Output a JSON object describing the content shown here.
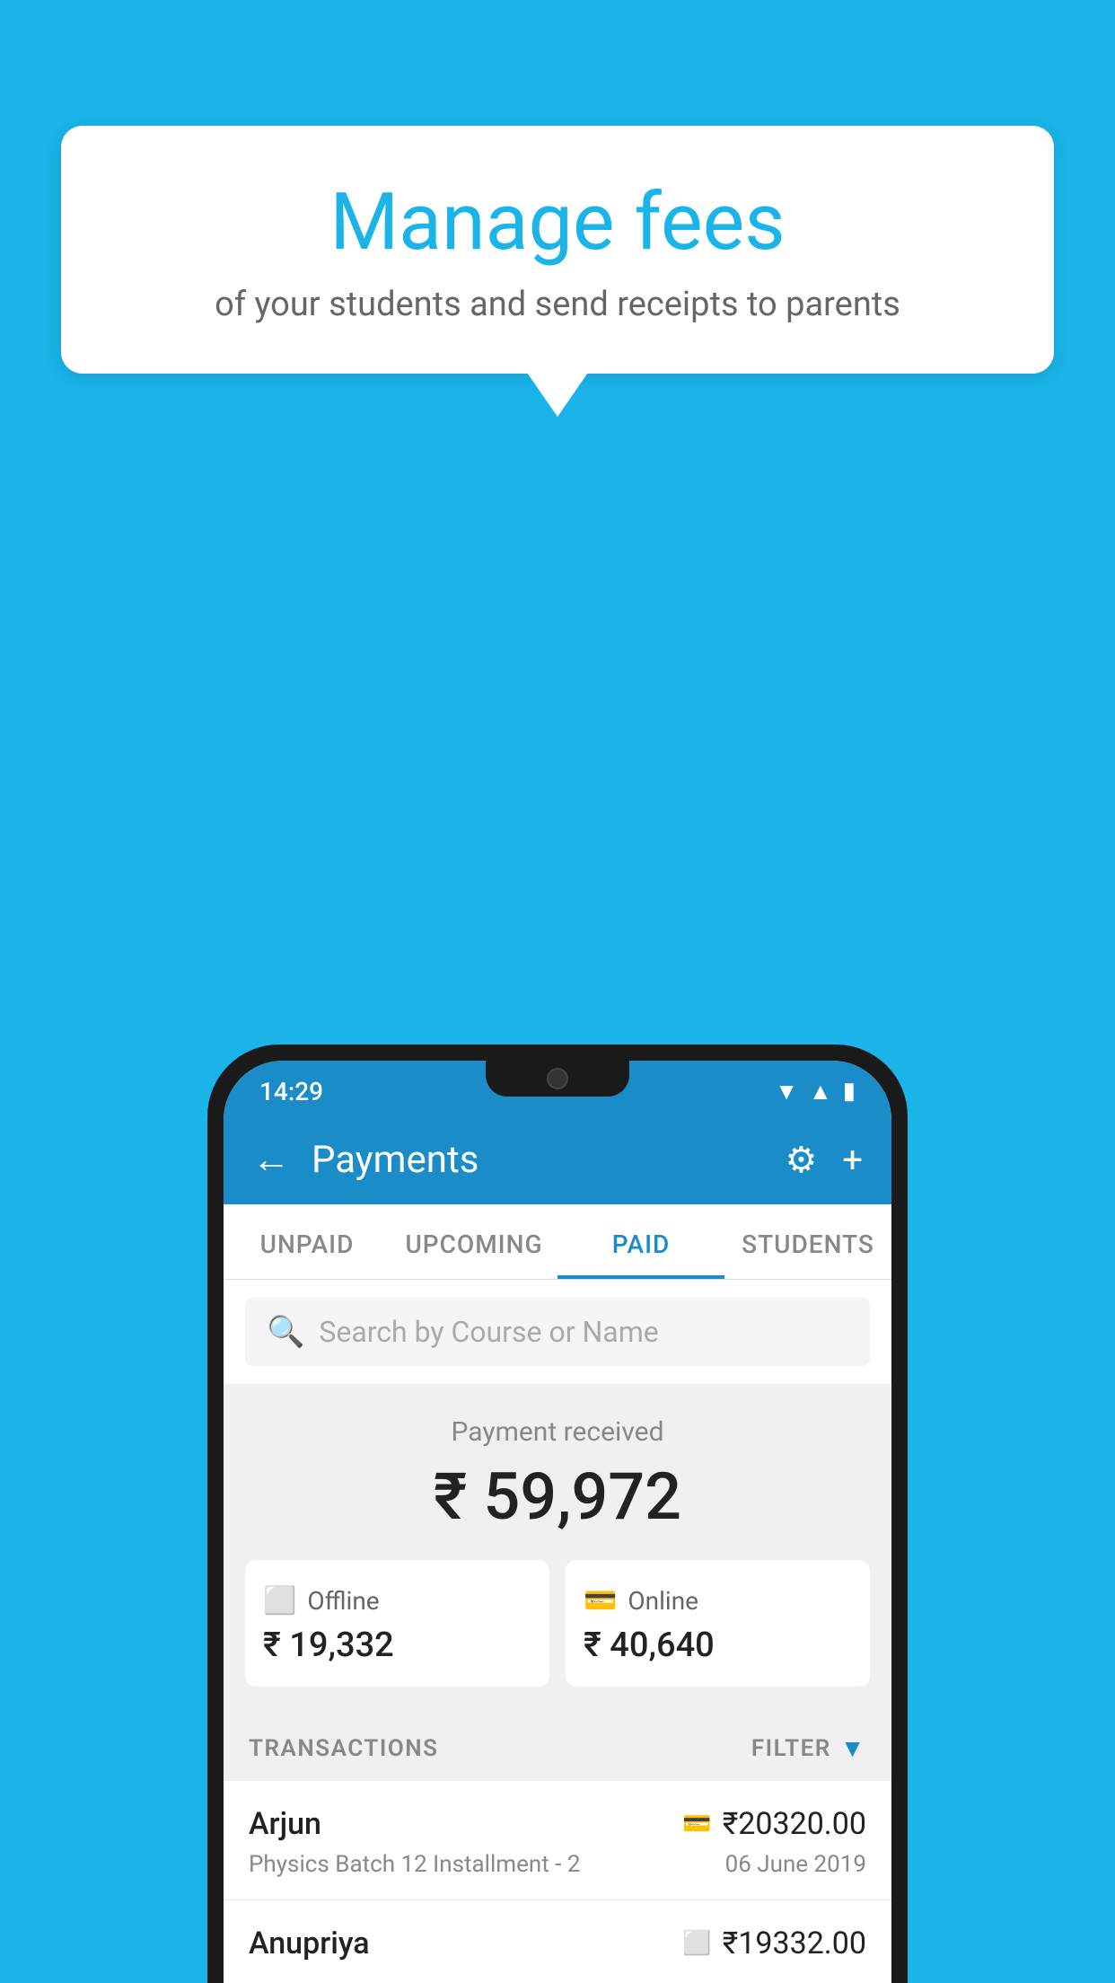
{
  "background_color": "#1ab4e8",
  "speech_bubble": {
    "title": "Manage fees",
    "subtitle": "of your students and send receipts to parents"
  },
  "status_bar": {
    "time": "14:29",
    "wifi": "▼",
    "signal": "▲",
    "battery": "▮"
  },
  "app_bar": {
    "title": "Payments",
    "back_icon": "←",
    "gear_icon": "⚙",
    "plus_icon": "+"
  },
  "tabs": [
    {
      "label": "UNPAID",
      "active": false
    },
    {
      "label": "UPCOMING",
      "active": false
    },
    {
      "label": "PAID",
      "active": true
    },
    {
      "label": "STUDENTS",
      "active": false
    }
  ],
  "search": {
    "placeholder": "Search by Course or Name"
  },
  "payment_summary": {
    "label": "Payment received",
    "amount": "₹ 59,972",
    "offline": {
      "label": "Offline",
      "amount": "₹ 19,332"
    },
    "online": {
      "label": "Online",
      "amount": "₹ 40,640"
    }
  },
  "transactions": {
    "label": "TRANSACTIONS",
    "filter_label": "FILTER",
    "rows": [
      {
        "name": "Arjun",
        "detail": "Physics Batch 12 Installment - 2",
        "amount": "₹20320.00",
        "date": "06 June 2019",
        "type": "online"
      },
      {
        "name": "Anupriya",
        "detail": "",
        "amount": "₹19332.00",
        "date": "",
        "type": "offline"
      }
    ]
  }
}
